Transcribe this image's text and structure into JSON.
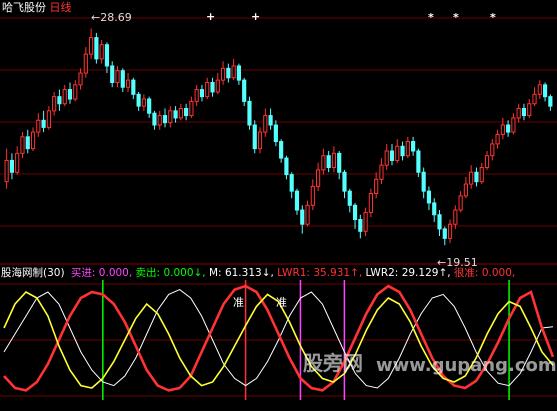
{
  "main_panel": {
    "stock_name": "哈飞股份",
    "period": "日线",
    "high_marker": "28.69",
    "low_marker": "19.51",
    "arrow_left": "←",
    "plus_marks": [
      "+",
      "+"
    ],
    "star_marks": [
      "*",
      "*",
      "*"
    ]
  },
  "indicator_panel": {
    "title": "股海网制(30)",
    "items": [
      {
        "label": "买进",
        "sep": ":",
        "value": "0.000",
        "suffix": ",",
        "color": "#ff44ff"
      },
      {
        "label": "卖出",
        "sep": ":",
        "value": "0.000",
        "suffix": "↓,",
        "color": "#00ff00"
      },
      {
        "label": "M",
        "sep": ":",
        "value": "61.313",
        "suffix": "↓,",
        "color": "#ffffff"
      },
      {
        "label": "LWR1",
        "sep": ":",
        "value": "35.931",
        "suffix": "↑,",
        "color": "#ff3333"
      },
      {
        "label": "LWR2",
        "sep": ":",
        "value": "29.129",
        "suffix": "↑,",
        "color": "#ffffff"
      },
      {
        "label": "很准",
        "sep": ":",
        "value": "0.000",
        "suffix": ",",
        "color": "#ff3333"
      }
    ],
    "annotations": [
      "准",
      "准"
    ]
  },
  "watermark": {
    "text_cn": "股旁网",
    "text_url": "www.gupang.com"
  },
  "colors": {
    "up": "#ff3333",
    "down": "#54ffff",
    "grid": "#8b0000",
    "title": "#ffffff",
    "period": "#ff3333"
  },
  "chart_data": [
    {
      "type": "candlestick",
      "title": "哈飞股份 日线",
      "max_label": 28.69,
      "min_label": 19.51,
      "ylim": [
        18.8,
        29.3
      ],
      "candles": [
        [
          22.2,
          23.1,
          23.6,
          21.9
        ],
        [
          23.1,
          22.6,
          23.4,
          22.3
        ],
        [
          22.6,
          23.4,
          23.7,
          22.5
        ],
        [
          23.4,
          24.1,
          24.3,
          23.2
        ],
        [
          24.1,
          23.6,
          24.4,
          23.4
        ],
        [
          23.6,
          24.3,
          24.5,
          23.5
        ],
        [
          24.3,
          24.8,
          25.1,
          24.1
        ],
        [
          24.8,
          24.5,
          25.2,
          24.3
        ],
        [
          24.5,
          25.2,
          25.4,
          24.4
        ],
        [
          25.2,
          25.8,
          26.0,
          25.0
        ],
        [
          25.8,
          25.5,
          26.1,
          25.2
        ],
        [
          25.5,
          26.1,
          26.3,
          25.4
        ],
        [
          26.1,
          25.7,
          26.4,
          25.5
        ],
        [
          25.7,
          26.3,
          26.5,
          25.6
        ],
        [
          26.3,
          26.8,
          27.0,
          26.1
        ],
        [
          26.8,
          27.6,
          27.9,
          26.6
        ],
        [
          27.6,
          28.3,
          28.69,
          27.4
        ],
        [
          28.3,
          27.4,
          28.5,
          27.2
        ],
        [
          27.4,
          28.0,
          28.2,
          27.2
        ],
        [
          28.0,
          27.1,
          28.1,
          26.8
        ],
        [
          27.1,
          26.4,
          27.3,
          26.2
        ],
        [
          26.4,
          26.9,
          27.1,
          26.2
        ],
        [
          26.9,
          26.2,
          27.0,
          26.0
        ],
        [
          26.2,
          26.5,
          26.8,
          26.0
        ],
        [
          26.5,
          25.9,
          26.6,
          25.7
        ],
        [
          25.9,
          25.4,
          26.0,
          25.2
        ],
        [
          25.4,
          25.7,
          25.9,
          25.2
        ],
        [
          25.7,
          25.1,
          25.8,
          24.9
        ],
        [
          25.1,
          24.6,
          25.2,
          24.4
        ],
        [
          24.6,
          25.0,
          25.2,
          24.4
        ],
        [
          25.0,
          24.7,
          25.3,
          24.5
        ],
        [
          24.7,
          25.2,
          25.4,
          24.5
        ],
        [
          25.2,
          24.9,
          25.4,
          24.7
        ],
        [
          24.9,
          25.3,
          25.5,
          24.8
        ],
        [
          25.3,
          25.0,
          25.5,
          24.8
        ],
        [
          25.0,
          25.6,
          25.8,
          24.9
        ],
        [
          25.6,
          26.1,
          26.3,
          25.4
        ],
        [
          26.1,
          25.8,
          26.3,
          25.6
        ],
        [
          25.8,
          26.4,
          26.6,
          25.7
        ],
        [
          26.4,
          26.0,
          26.6,
          25.8
        ],
        [
          26.0,
          26.5,
          26.8,
          25.9
        ],
        [
          26.5,
          27.0,
          27.3,
          26.3
        ],
        [
          27.0,
          26.6,
          27.2,
          26.4
        ],
        [
          26.6,
          27.1,
          27.4,
          26.5
        ],
        [
          27.1,
          26.5,
          27.2,
          26.3
        ],
        [
          26.5,
          25.6,
          26.6,
          25.4
        ],
        [
          25.6,
          24.6,
          25.8,
          24.4
        ],
        [
          24.6,
          23.6,
          24.8,
          23.4
        ],
        [
          23.6,
          24.3,
          24.5,
          23.4
        ],
        [
          24.3,
          25.0,
          25.3,
          24.1
        ],
        [
          25.0,
          24.6,
          25.3,
          24.4
        ],
        [
          24.6,
          23.9,
          24.8,
          23.7
        ],
        [
          23.9,
          23.2,
          24.0,
          23.0
        ],
        [
          23.2,
          22.5,
          23.3,
          22.3
        ],
        [
          22.5,
          21.8,
          22.6,
          21.5
        ],
        [
          21.8,
          21.0,
          21.9,
          20.8
        ],
        [
          21.0,
          20.4,
          21.2,
          20.0
        ],
        [
          20.4,
          21.2,
          21.4,
          20.3
        ],
        [
          21.2,
          22.0,
          22.3,
          21.0
        ],
        [
          22.0,
          22.7,
          23.0,
          21.8
        ],
        [
          22.7,
          23.3,
          23.6,
          22.5
        ],
        [
          23.3,
          22.8,
          23.5,
          22.6
        ],
        [
          22.8,
          23.4,
          23.7,
          22.6
        ],
        [
          23.4,
          22.6,
          23.5,
          22.3
        ],
        [
          22.6,
          21.8,
          22.7,
          21.5
        ],
        [
          21.8,
          21.2,
          21.9,
          20.9
        ],
        [
          21.2,
          20.6,
          21.3,
          20.2
        ],
        [
          20.6,
          20.1,
          20.8,
          19.8
        ],
        [
          20.1,
          20.9,
          21.1,
          19.9
        ],
        [
          20.9,
          21.7,
          21.9,
          20.7
        ],
        [
          21.7,
          22.3,
          22.6,
          21.5
        ],
        [
          22.3,
          22.9,
          23.2,
          22.1
        ],
        [
          22.9,
          23.5,
          23.8,
          22.7
        ],
        [
          23.5,
          23.1,
          23.8,
          22.9
        ],
        [
          23.1,
          23.7,
          24.0,
          23.0
        ],
        [
          23.7,
          23.3,
          23.9,
          23.1
        ],
        [
          23.3,
          23.9,
          24.1,
          23.2
        ],
        [
          23.9,
          23.5,
          24.1,
          23.3
        ],
        [
          23.5,
          22.6,
          23.6,
          22.4
        ],
        [
          22.6,
          21.8,
          22.8,
          21.5
        ],
        [
          21.8,
          21.3,
          22.0,
          21.0
        ],
        [
          21.3,
          20.8,
          21.5,
          20.5
        ],
        [
          20.8,
          20.2,
          21.0,
          19.9
        ],
        [
          20.2,
          19.8,
          20.3,
          19.51
        ],
        [
          19.8,
          20.4,
          20.6,
          19.6
        ],
        [
          20.4,
          21.0,
          21.2,
          20.2
        ],
        [
          21.0,
          21.6,
          21.8,
          20.9
        ],
        [
          21.6,
          22.1,
          22.4,
          21.5
        ],
        [
          22.1,
          22.6,
          22.9,
          21.9
        ],
        [
          22.6,
          22.2,
          22.8,
          22.0
        ],
        [
          22.2,
          22.8,
          23.0,
          22.1
        ],
        [
          22.8,
          23.3,
          23.5,
          22.7
        ],
        [
          23.3,
          23.8,
          24.0,
          23.1
        ],
        [
          23.8,
          24.2,
          24.4,
          23.6
        ],
        [
          24.2,
          24.6,
          24.9,
          24.0
        ],
        [
          24.6,
          24.3,
          24.8,
          24.1
        ],
        [
          24.3,
          24.9,
          25.1,
          24.2
        ],
        [
          24.9,
          25.3,
          25.5,
          24.7
        ],
        [
          25.3,
          25.0,
          25.5,
          24.8
        ],
        [
          25.0,
          25.5,
          25.7,
          24.9
        ],
        [
          25.5,
          25.9,
          26.2,
          25.4
        ],
        [
          25.9,
          26.3,
          26.5,
          25.7
        ],
        [
          26.3,
          25.8,
          26.4,
          25.6
        ],
        [
          25.8,
          25.4,
          25.9,
          25.2
        ]
      ]
    },
    {
      "type": "line",
      "title": "股海网制(30)",
      "ylim": [
        0,
        100
      ],
      "series": [
        {
          "name": "M",
          "color": "#ffffff",
          "values": [
            40,
            55,
            70,
            85,
            90,
            80,
            60,
            40,
            25,
            15,
            12,
            20,
            35,
            55,
            75,
            88,
            92,
            85,
            70,
            50,
            30,
            18,
            12,
            18,
            32,
            50,
            70,
            85,
            90,
            80,
            60,
            40,
            22,
            12,
            10,
            18,
            35,
            55,
            72,
            85,
            88,
            78,
            60,
            40,
            24,
            14,
            12,
            22,
            40,
            60,
            61
          ]
        },
        {
          "name": "LWR1",
          "color": "#ff3333",
          "values": [
            20,
            10,
            8,
            15,
            30,
            50,
            70,
            85,
            90,
            88,
            80,
            65,
            45,
            25,
            12,
            8,
            10,
            20,
            40,
            60,
            80,
            92,
            95,
            90,
            75,
            55,
            35,
            18,
            10,
            8,
            15,
            32,
            52,
            72,
            88,
            95,
            90,
            75,
            55,
            35,
            20,
            12,
            10,
            16,
            30,
            48,
            68,
            85,
            90,
            60,
            36
          ]
        },
        {
          "name": "LWR2",
          "color": "#ffff33",
          "values": [
            60,
            80,
            90,
            85,
            70,
            45,
            25,
            12,
            10,
            18,
            32,
            50,
            68,
            80,
            72,
            55,
            35,
            20,
            12,
            15,
            28,
            45,
            62,
            78,
            88,
            82,
            65,
            45,
            28,
            18,
            15,
            22,
            38,
            58,
            75,
            85,
            80,
            65,
            45,
            28,
            18,
            15,
            20,
            35,
            55,
            72,
            82,
            78,
            60,
            40,
            29
          ]
        }
      ],
      "vertical_marks": [
        {
          "index": 9,
          "color": "#00ff00"
        },
        {
          "index": 22,
          "color": "#ff3333"
        },
        {
          "index": 27,
          "color": "#ff44ff"
        },
        {
          "index": 31,
          "color": "#ff44ff"
        },
        {
          "index": 46,
          "color": "#00ff00"
        }
      ]
    }
  ]
}
